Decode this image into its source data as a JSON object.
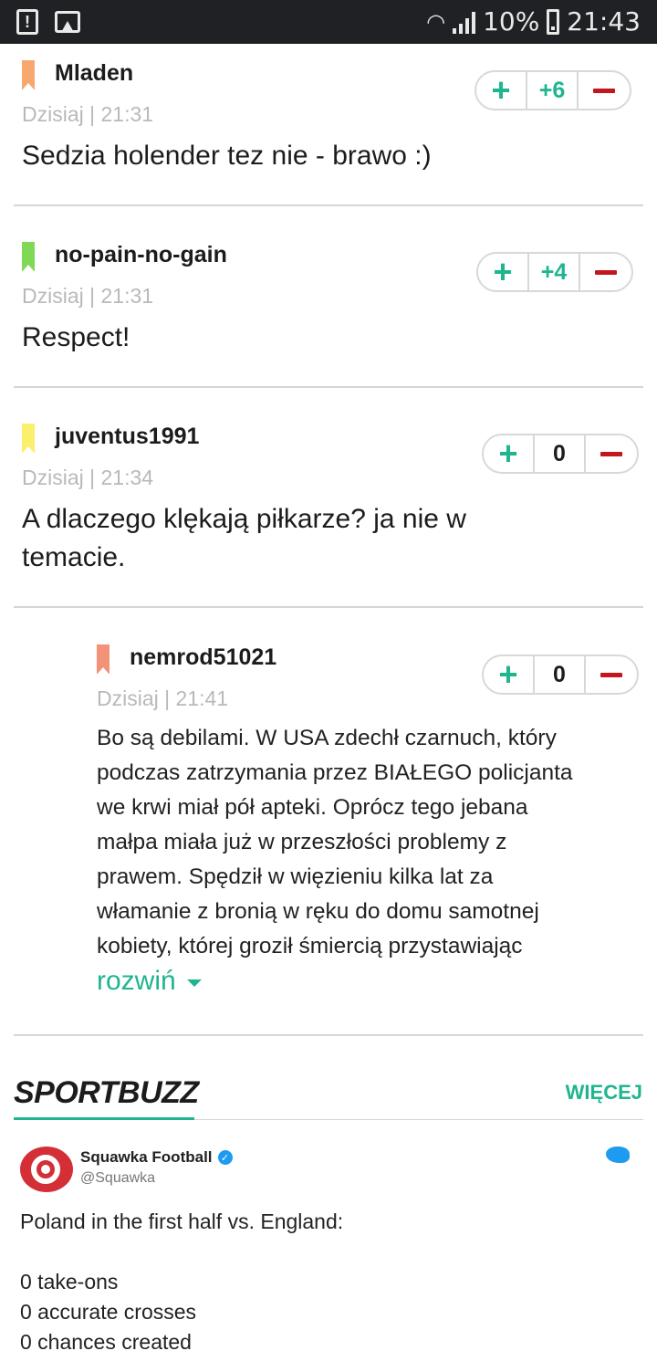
{
  "status_bar": {
    "battery": "10%",
    "time": "21:43"
  },
  "comments": [
    {
      "author": "Mladen",
      "date": "Dzisiaj",
      "time": "21:31",
      "text": "Sedzia holender tez nie - brawo :)",
      "score": "+6",
      "flag_color": "#f7a86e"
    },
    {
      "author": "no-pain-no-gain",
      "date": "Dzisiaj",
      "time": "21:31",
      "text": "Respect!",
      "score": "+4",
      "flag_color": "#7fd957"
    },
    {
      "author": "juventus1991",
      "date": "Dzisiaj",
      "time": "21:34",
      "text_line1": "A dlaczego klękają piłkarze? ja nie w",
      "text_line2": "temacie.",
      "score": "0",
      "flag_color": "#fbef6b"
    },
    {
      "author": "nemrod51021",
      "date": "Dzisiaj",
      "time": "21:41",
      "score": "0",
      "flag_color": "#f29277",
      "lines": [
        "Bo są debilami. W USA zdechł czarnuch, który",
        "podczas zatrzymania przez BIAŁEGO policjanta",
        "we krwi miał pół apteki. Oprócz tego jebana",
        "małpa miała już w przeszłości problemy z",
        "prawem. Spędził w więzieniu kilka lat za",
        "włamanie z bronią w ręku do domu samotnej",
        "kobiety, której groził śmiercią przystawiając"
      ],
      "expand_label": "rozwiń"
    }
  ],
  "date_separator": "|",
  "sportbuzz": {
    "title": "SPORTBUZZ",
    "more_label": "WIĘCEJ"
  },
  "tweet": {
    "name": "Squawka Football",
    "handle": "@Squawka",
    "lines": [
      "Poland in the first half vs. England:",
      "",
      "0 take-ons",
      "0 accurate crosses",
      "0 chances created"
    ]
  }
}
